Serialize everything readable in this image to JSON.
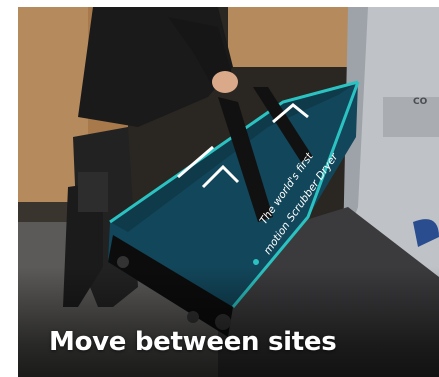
{
  "card": {
    "caption": "Move between sites",
    "photo_subject": "technician-loading-scrubber-dryer-bag-into-van"
  },
  "bag": {
    "print_line_1": "The world's first",
    "print_line_2": "motion Scrubber Dryer",
    "color": "#12465a",
    "trim_color": "#2bc3c2"
  }
}
